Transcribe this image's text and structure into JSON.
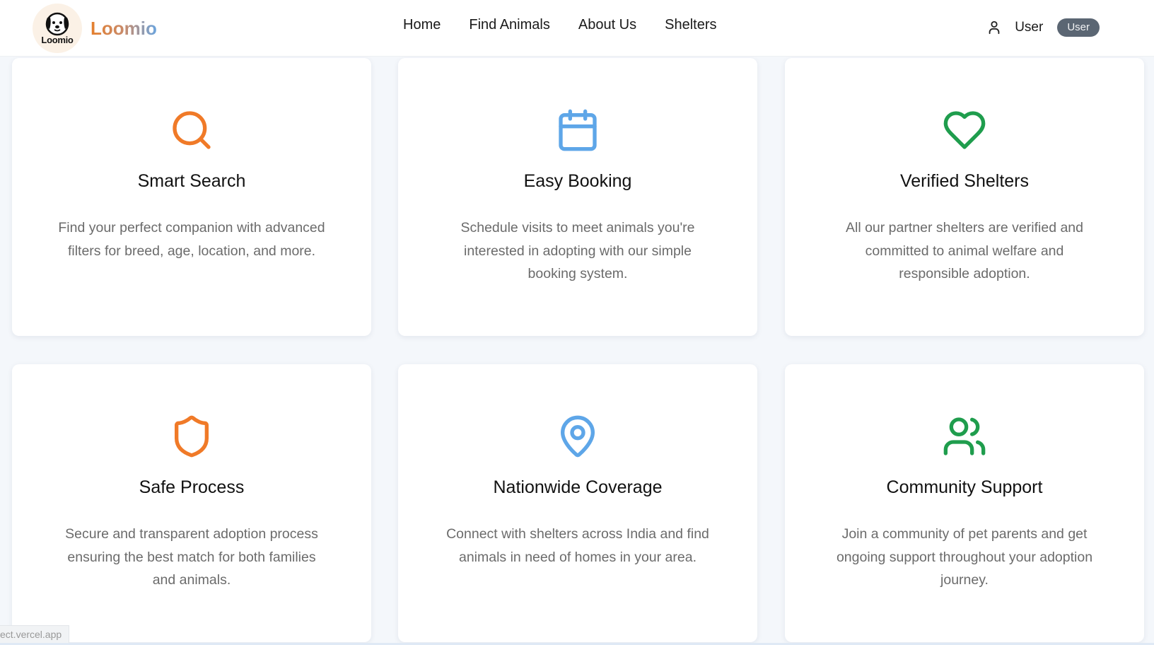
{
  "header": {
    "logo_text": "Loomio",
    "brand_name": "Loomio",
    "nav": [
      "Home",
      "Find Animals",
      "About Us",
      "Shelters"
    ],
    "user_name": "User",
    "user_badge": "User"
  },
  "features": [
    {
      "title": "Smart Search",
      "description": "Find your perfect companion with advanced filters for breed, age, location, and more.",
      "icon": "search-icon",
      "color": "#f07a28"
    },
    {
      "title": "Easy Booking",
      "description": "Schedule visits to meet animals you're interested in adopting with our simple booking system.",
      "icon": "calendar-icon",
      "color": "#5ea6e8"
    },
    {
      "title": "Verified Shelters",
      "description": "All our partner shelters are verified and committed to animal welfare and responsible adoption.",
      "icon": "heart-icon",
      "color": "#1f9d4d"
    },
    {
      "title": "Safe Process",
      "description": "Secure and transparent adoption process ensuring the best match for both families and animals.",
      "icon": "shield-icon",
      "color": "#f07a28"
    },
    {
      "title": "Nationwide Coverage",
      "description": "Connect with shelters across India and find animals in need of homes in your area.",
      "icon": "map-pin-icon",
      "color": "#5ea6e8"
    },
    {
      "title": "Community Support",
      "description": "Join a community of pet parents and get ongoing support throughout your adoption journey.",
      "icon": "users-icon",
      "color": "#1f9d4d"
    }
  ],
  "status_bar": {
    "url": "ect.vercel.app"
  }
}
